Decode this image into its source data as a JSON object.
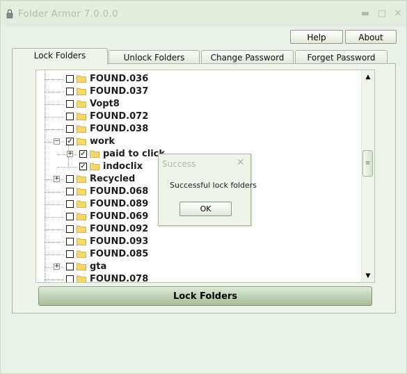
{
  "window": {
    "title": "Folder Armor 7.0.0.0"
  },
  "top_buttons": {
    "help": "Help",
    "about": "About"
  },
  "tabs": [
    {
      "label": "Lock Folders",
      "active": true
    },
    {
      "label": "Unlock Folders",
      "active": false
    },
    {
      "label": "Change Password",
      "active": false
    },
    {
      "label": "Forget Password",
      "active": false
    }
  ],
  "tree": {
    "items": [
      {
        "label": "FOUND.036",
        "checked": false,
        "expander": ""
      },
      {
        "label": "FOUND.037",
        "checked": false,
        "expander": ""
      },
      {
        "label": "Vopt8",
        "checked": false,
        "expander": ""
      },
      {
        "label": "FOUND.072",
        "checked": false,
        "expander": ""
      },
      {
        "label": "FOUND.038",
        "checked": false,
        "expander": ""
      },
      {
        "label": "work",
        "checked": true,
        "expander": "minus"
      },
      {
        "label": "paid to click",
        "checked": true,
        "expander": "plus",
        "child": true
      },
      {
        "label": "indoclix",
        "checked": true,
        "expander": "",
        "child": true
      },
      {
        "label": "Recycled",
        "checked": false,
        "expander": "plus"
      },
      {
        "label": "FOUND.068",
        "checked": false,
        "expander": ""
      },
      {
        "label": "FOUND.089",
        "checked": false,
        "expander": ""
      },
      {
        "label": "FOUND.069",
        "checked": false,
        "expander": ""
      },
      {
        "label": "FOUND.092",
        "checked": false,
        "expander": ""
      },
      {
        "label": "FOUND.093",
        "checked": false,
        "expander": ""
      },
      {
        "label": "FOUND.085",
        "checked": false,
        "expander": ""
      },
      {
        "label": "gta",
        "checked": false,
        "expander": "plus"
      },
      {
        "label": "FOUND.078",
        "checked": false,
        "expander": ""
      }
    ]
  },
  "lock_button": "Lock Folders",
  "dialog": {
    "title": "Success",
    "message": "Successful lock folders",
    "ok": "OK"
  },
  "colors": {
    "folder": "#f5d76b",
    "accent": "#b9cdb0"
  }
}
